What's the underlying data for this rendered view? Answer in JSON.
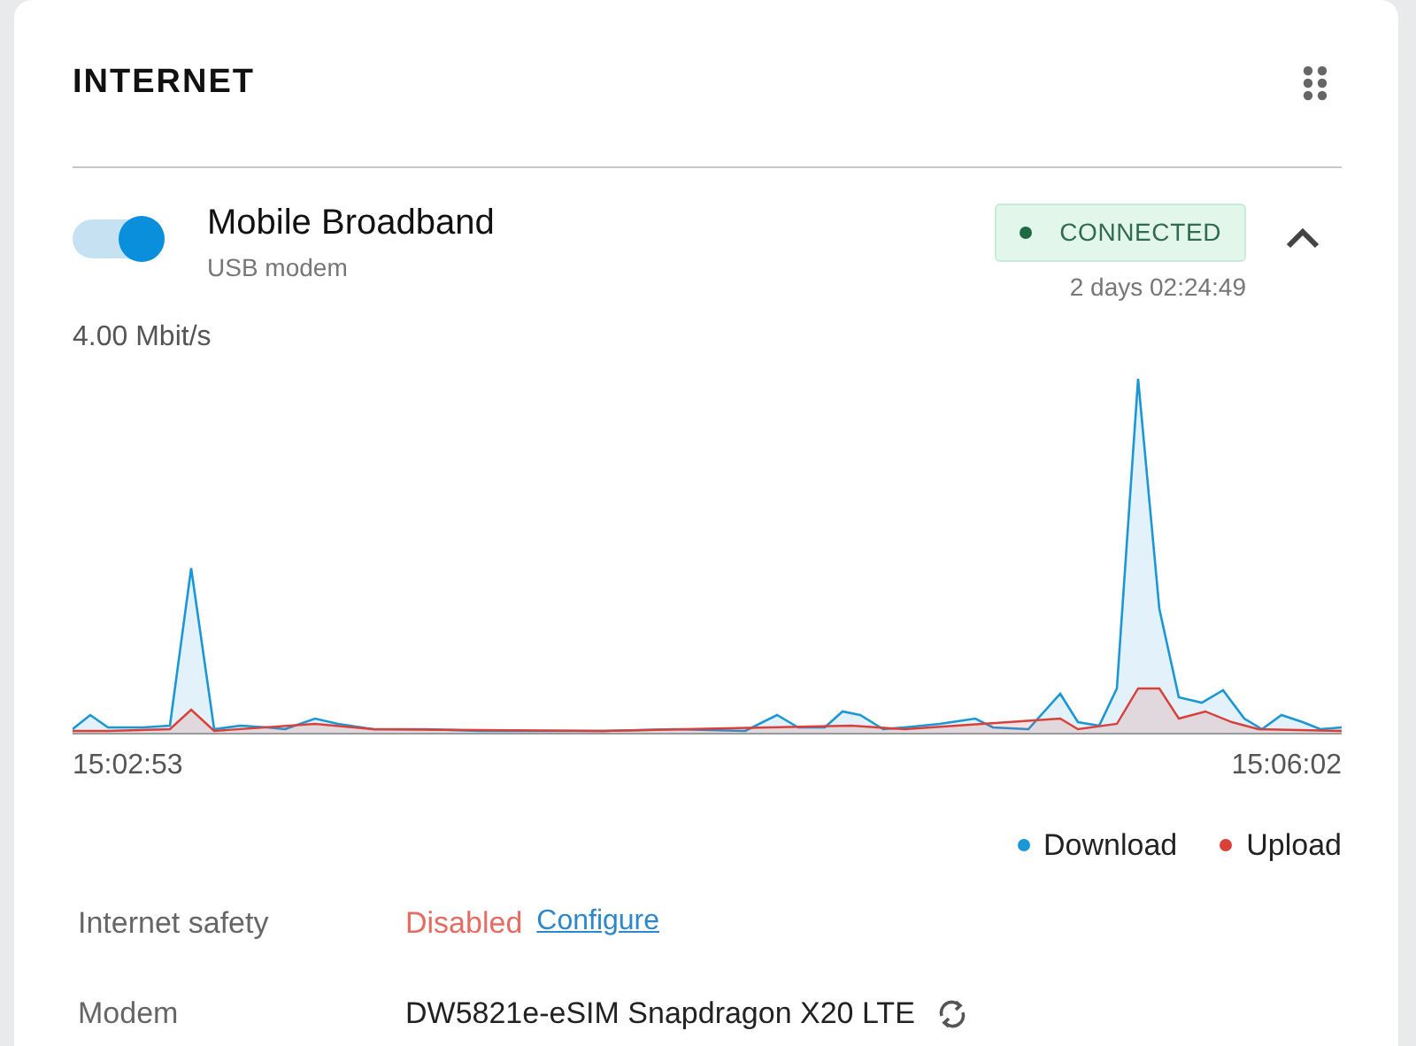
{
  "panel": {
    "title": "INTERNET"
  },
  "connection": {
    "name": "Mobile Broadband",
    "subtitle": "USB modem",
    "on": true,
    "status": "CONNECTED",
    "connected": true,
    "uptime": "2 days 02:24:49",
    "expanded": true
  },
  "graph": {
    "max_label": "4.00 Mbit/s",
    "start_time": "15:02:53",
    "end_time": "15:06:02"
  },
  "legend": [
    {
      "label": "Download",
      "color": "#1a97d4"
    },
    {
      "label": "Upload",
      "color": "#d9403a"
    }
  ],
  "details": [
    {
      "kind": "status",
      "label": "Internet safety",
      "value": "Disabled",
      "link": "Configure"
    },
    {
      "kind": "device",
      "label": "Modem",
      "value": "DW5821e-eSIM Snapdragon X20 LTE"
    }
  ]
}
